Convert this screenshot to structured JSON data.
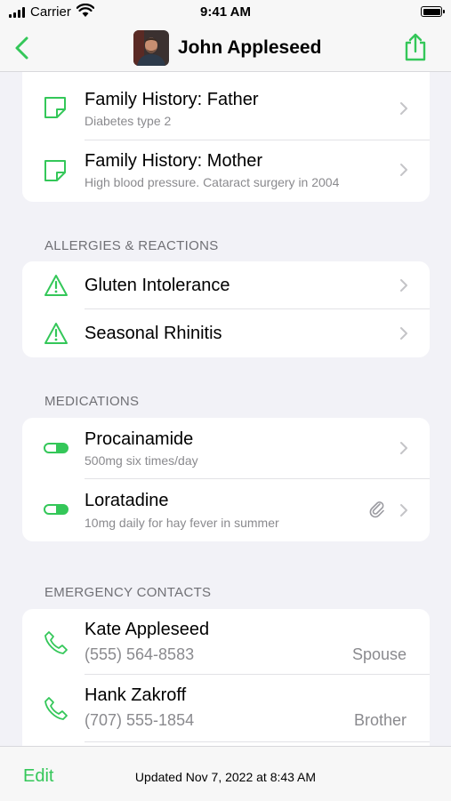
{
  "status_bar": {
    "carrier": "Carrier",
    "time": "9:41 AM"
  },
  "nav": {
    "title": "John Appleseed"
  },
  "family_history": [
    {
      "title": "Family History: Father",
      "subtitle": "Diabetes type 2"
    },
    {
      "title": "Family History: Mother",
      "subtitle": "High blood pressure. Cataract surgery in 2004"
    }
  ],
  "allergies": {
    "header": "ALLERGIES & REACTIONS",
    "items": [
      {
        "title": "Gluten Intolerance"
      },
      {
        "title": "Seasonal Rhinitis"
      }
    ]
  },
  "medications": {
    "header": "MEDICATIONS",
    "items": [
      {
        "title": "Procainamide",
        "subtitle": "500mg six times/day"
      },
      {
        "title": "Loratadine",
        "subtitle": "10mg daily for hay fever in summer"
      }
    ]
  },
  "emergency_contacts": {
    "header": "EMERGENCY CONTACTS",
    "items": [
      {
        "name": "Kate Appleseed",
        "phone": "(555) 564-8583",
        "relation": "Spouse"
      },
      {
        "name": "Hank Zakroff",
        "phone": "(707) 555-1854",
        "relation": "Brother"
      }
    ]
  },
  "toolbar": {
    "edit_label": "Edit",
    "updated_text": "Updated Nov 7, 2022 at 8:43 AM"
  },
  "colors": {
    "accent": "#34C759",
    "background": "#F2F2F7",
    "secondary_text": "#8A8A8E"
  },
  "icons": {
    "back": "chevron-left-icon",
    "share": "share-icon",
    "note": "note-icon",
    "allergy": "warning-triangle-icon",
    "medication": "pill-icon",
    "contact": "phone-icon",
    "attachment": "paperclip-icon",
    "disclosure": "chevron-right-icon"
  }
}
